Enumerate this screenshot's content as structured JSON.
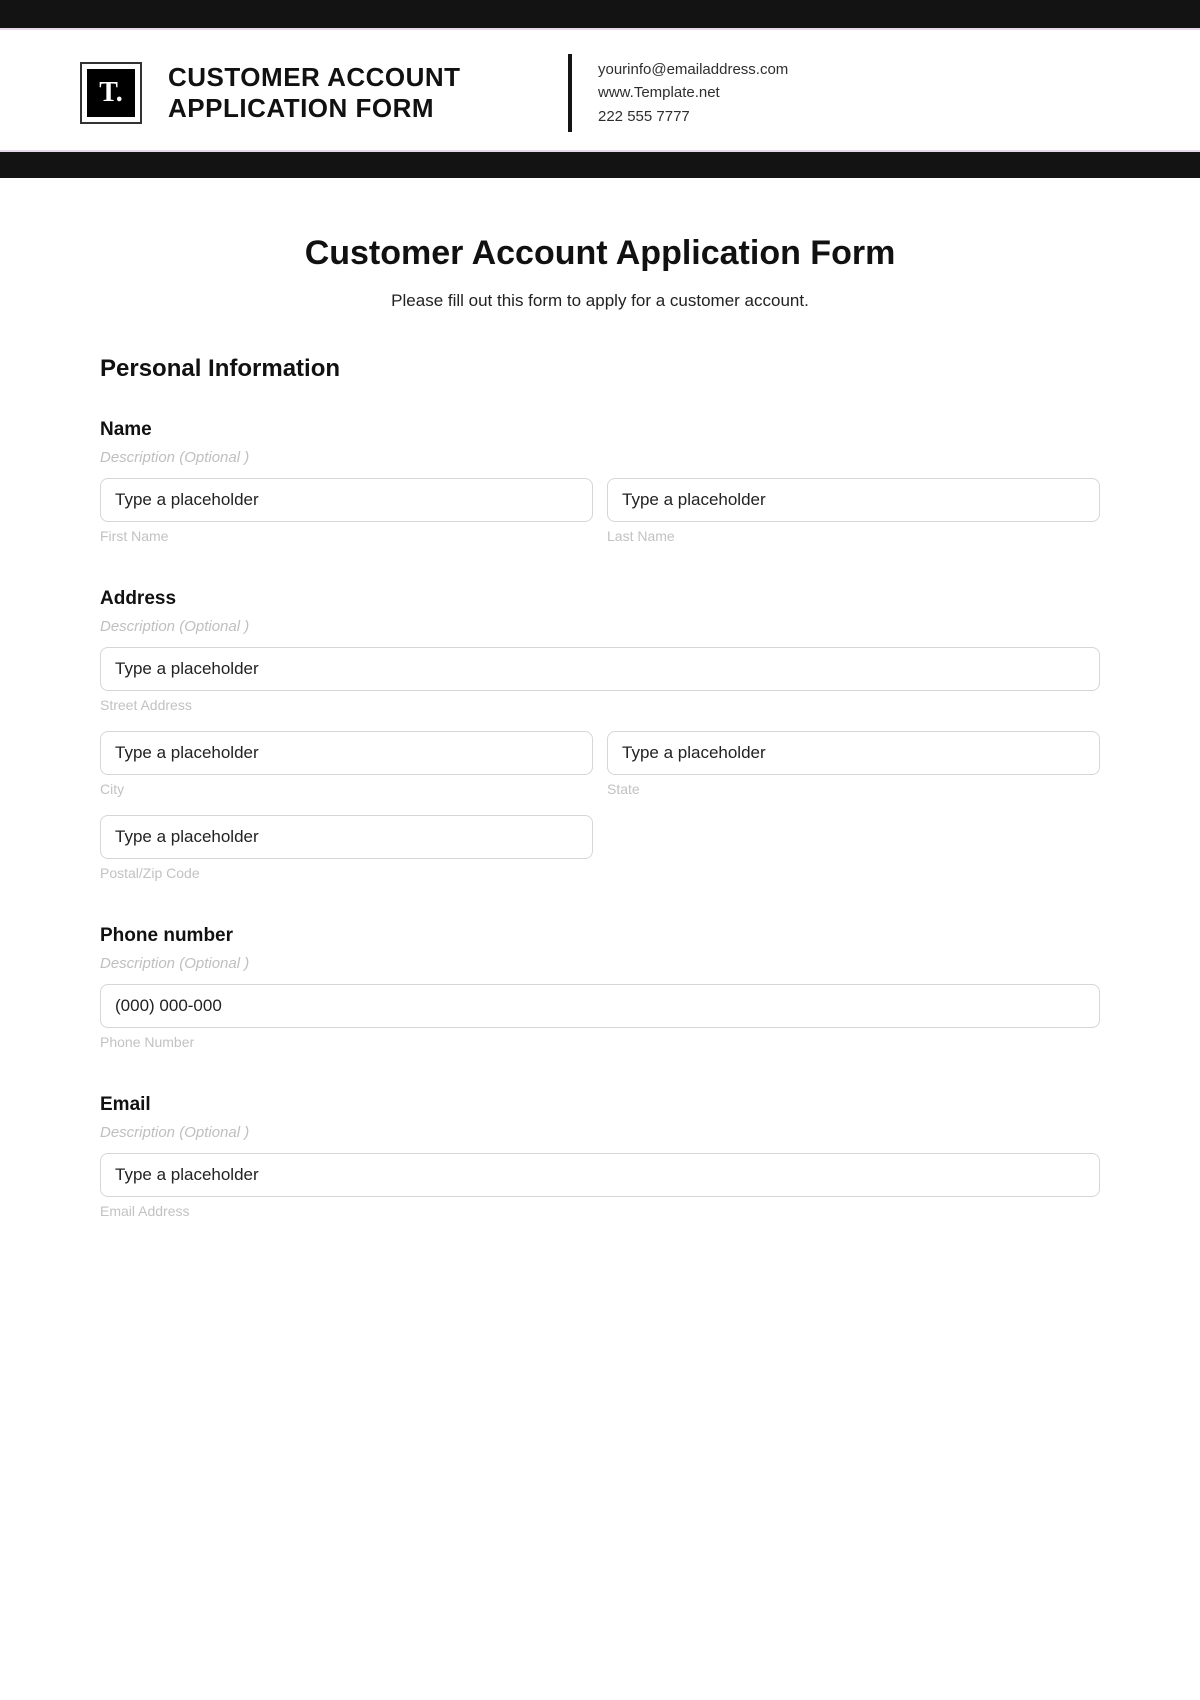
{
  "header": {
    "logo_text": "T.",
    "title": "CUSTOMER ACCOUNT APPLICATION FORM",
    "contact": {
      "email": "yourinfo@emailaddress.com",
      "website": "www.Template.net",
      "phone": "222 555 7777"
    }
  },
  "page": {
    "title": "Customer Account Application Form",
    "subtitle": "Please fill out this form to apply for a customer account."
  },
  "section_personal": "Personal Information",
  "desc_optional": "Description  (Optional )",
  "placeholders": {
    "generic": "Type a placeholder",
    "phone": "(000) 000-000"
  },
  "fields": {
    "name": {
      "label": "Name",
      "first_sub": "First Name",
      "last_sub": "Last Name"
    },
    "address": {
      "label": "Address",
      "street_sub": "Street Address",
      "city_sub": "City",
      "state_sub": "State",
      "zip_sub": "Postal/Zip Code"
    },
    "phone": {
      "label": "Phone number",
      "sub": "Phone Number"
    },
    "email": {
      "label": "Email",
      "sub": "Email Address"
    }
  }
}
